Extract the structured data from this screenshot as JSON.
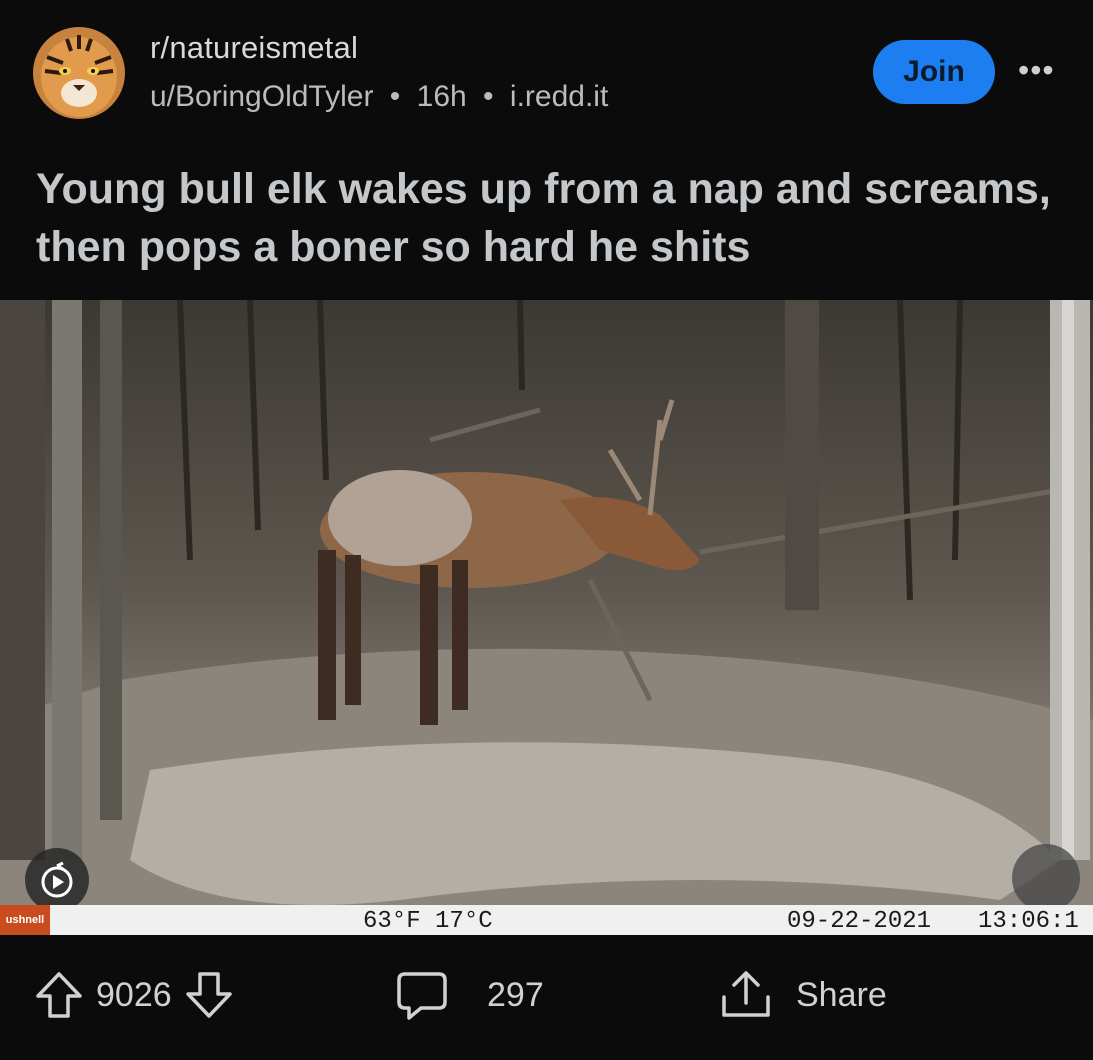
{
  "post": {
    "subreddit": "r/natureismetal",
    "author": "u/BoringOldTyler",
    "age": "16h",
    "domain": "i.redd.it",
    "separator": "•",
    "join_label": "Join",
    "more_label": "•••",
    "title": "Young bull elk wakes up from a nap and screams, then pops a boner so hard he shits"
  },
  "media": {
    "camera_brand": "ushnell",
    "temperature": "63°F 17°C",
    "date": "09-22-2021",
    "time": "13:06:1"
  },
  "actions": {
    "upvotes": "9026",
    "comments": "297",
    "share_label": "Share"
  },
  "colors": {
    "background": "#0b0b0c",
    "join_button": "#1c7ef0",
    "title_text": "#c5c8cb"
  }
}
